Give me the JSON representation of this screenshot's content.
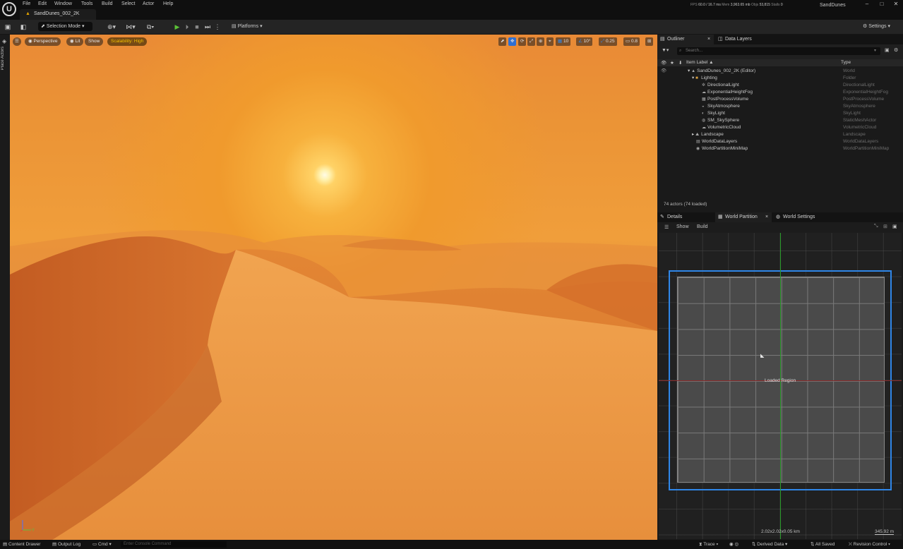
{
  "app": {
    "logo_glyph": "U",
    "menu": [
      "File",
      "Edit",
      "Window",
      "Tools",
      "Build",
      "Select",
      "Actor",
      "Help"
    ],
    "level_tab": "SandDunes_002_2K",
    "project": "SandDunes",
    "stats": {
      "fps_label": "FPS",
      "fps": "60.0",
      "ms": "/ 16.7 ms",
      "mem_label": "Mem",
      "mem": "3,963.65 mb",
      "objs_label": "Objs",
      "objs": "53,815",
      "stalls_label": "Stalls",
      "stalls": "0"
    }
  },
  "toolbar": {
    "selection_mode": "Selection Mode",
    "platforms": "Platforms",
    "settings": "Settings"
  },
  "sidebar": {
    "place_actors": "Place Actors"
  },
  "viewport": {
    "perspective": "Perspective",
    "lit": "Lit",
    "show": "Show",
    "scalability": "Scalability: High",
    "grid_snap": "10",
    "rotation_snap": "10°",
    "scale_snap": "0.25",
    "camera_speed": "0.8"
  },
  "outliner": {
    "tab": "Outliner",
    "data_layers_tab": "Data Layers",
    "search_placeholder": "Search...",
    "col_label": "Item Label ▲",
    "col_type": "Type",
    "rows": [
      {
        "label": "SandDunes_002_2K (Editor)",
        "type": "World",
        "icon": "world-icon"
      },
      {
        "label": "Lighting",
        "type": "Folder",
        "icon": "folder-icon"
      },
      {
        "label": "DirectionalLight",
        "type": "DirectionalLight",
        "icon": "directional-light-icon"
      },
      {
        "label": "ExponentialHeightFog",
        "type": "ExponentialHeightFog",
        "icon": "fog-icon"
      },
      {
        "label": "PostProcessVolume",
        "type": "PostProcessVolume",
        "icon": "volume-icon"
      },
      {
        "label": "SkyAtmosphere",
        "type": "SkyAtmosphere",
        "icon": "sky-atmosphere-icon"
      },
      {
        "label": "SkyLight",
        "type": "SkyLight",
        "icon": "skylight-icon"
      },
      {
        "label": "SM_SkySphere",
        "type": "StaticMeshActor",
        "icon": "static-mesh-icon"
      },
      {
        "label": "VolumetricCloud",
        "type": "VolumetricCloud",
        "icon": "cloud-icon"
      },
      {
        "label": "Landscape",
        "type": "Landscape",
        "icon": "landscape-icon"
      },
      {
        "label": "WorldDataLayers",
        "type": "WorldDataLayers",
        "icon": "data-layers-icon"
      },
      {
        "label": "WorldPartitionMiniMap",
        "type": "WorldPartitionMiniMap",
        "icon": "minimap-icon"
      }
    ],
    "actor_count": "74 actors (74 loaded)"
  },
  "world_partition": {
    "details_tab": "Details",
    "wp_tab": "World Partition",
    "world_settings_tab": "World Settings",
    "show": "Show",
    "build": "Build",
    "region_label": "Loaded Region",
    "size": "2.02x2.02x0.05 km",
    "scale": "345.92 m"
  },
  "statusbar": {
    "content_drawer": "Content Drawer",
    "output_log": "Output Log",
    "cmd": "Cmd",
    "console_placeholder": "Enter Console Command",
    "trace": "Trace",
    "derived_data": "Derived Data",
    "all_saved": "All Saved",
    "revision_control": "Revision Control"
  }
}
